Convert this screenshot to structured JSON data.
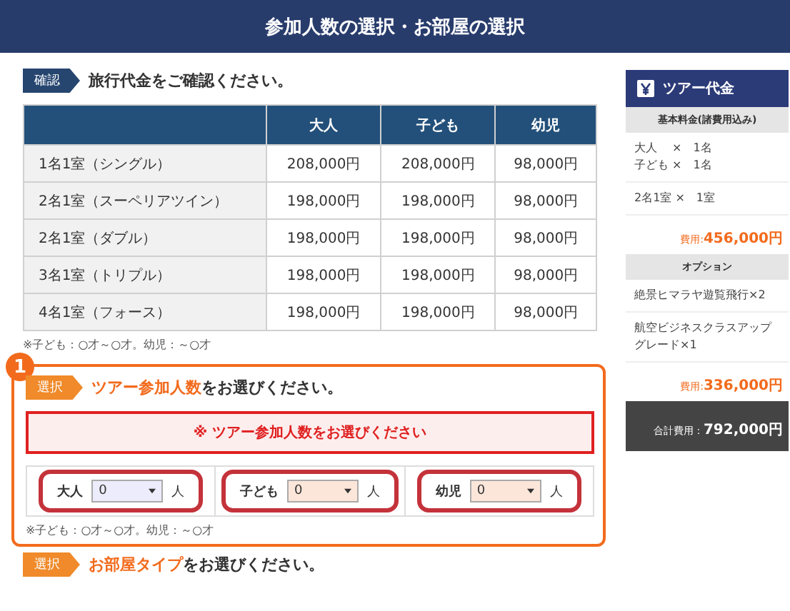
{
  "header": {
    "title": "参加人数の選択・お部屋の選択"
  },
  "confirm": {
    "tag": "確認",
    "heading": "旅行代金をご確認ください。"
  },
  "price_table": {
    "columns": [
      "",
      "大人",
      "子ども",
      "幼児"
    ],
    "rows": [
      [
        "1名1室（シングル）",
        "208,000円",
        "208,000円",
        "98,000円"
      ],
      [
        "2名1室（スーペリアツイン）",
        "198,000円",
        "198,000円",
        "98,000円"
      ],
      [
        "2名1室（ダブル）",
        "198,000円",
        "198,000円",
        "98,000円"
      ],
      [
        "3名1室（トリプル）",
        "198,000円",
        "198,000円",
        "98,000円"
      ],
      [
        "4名1室（フォース）",
        "198,000円",
        "198,000円",
        "98,000円"
      ]
    ],
    "note": "※子ども：○才～○才。幼児：～○才"
  },
  "step1": {
    "badge": "1",
    "tag": "選択",
    "heading_highlight": "ツアー参加人数",
    "heading_rest": "をお選びください。",
    "highlighted": true,
    "alert": "※ ツアー参加人数をお選びください",
    "counts": [
      {
        "label": "大人",
        "value": "0",
        "unit": "人",
        "color": "#ececfc",
        "highlighted": true
      },
      {
        "label": "子ども",
        "value": "0",
        "unit": "人",
        "color": "#fce6da",
        "highlighted": true
      },
      {
        "label": "幼児",
        "value": "0",
        "unit": "人",
        "color": "#fce6da",
        "highlighted": true
      }
    ],
    "note": "※子ども：○才～○才。幼児：～○才"
  },
  "step2": {
    "tag": "選択",
    "heading_highlight": "お部屋タイプ",
    "heading_rest": "をお選びください。"
  },
  "summary": {
    "title": "ツアー代金",
    "sections": [
      {
        "heading": "基本料金(諸費用込み)",
        "lines": [
          [
            "大人　 ×　1名",
            "子ども ×　1名"
          ],
          [
            "2名1室 ×　1室"
          ]
        ],
        "subtotal_label": "費用:",
        "subtotal": "456,000円"
      },
      {
        "heading": "オプション",
        "lines": [
          [
            "絶景ヒマラヤ遊覧飛行×2"
          ],
          [
            "航空ビジネスクラスアップグレード×1"
          ]
        ],
        "subtotal_label": "費用:",
        "subtotal": "336,000円"
      }
    ],
    "total_label": "合計費用：",
    "total": "792,000円"
  }
}
